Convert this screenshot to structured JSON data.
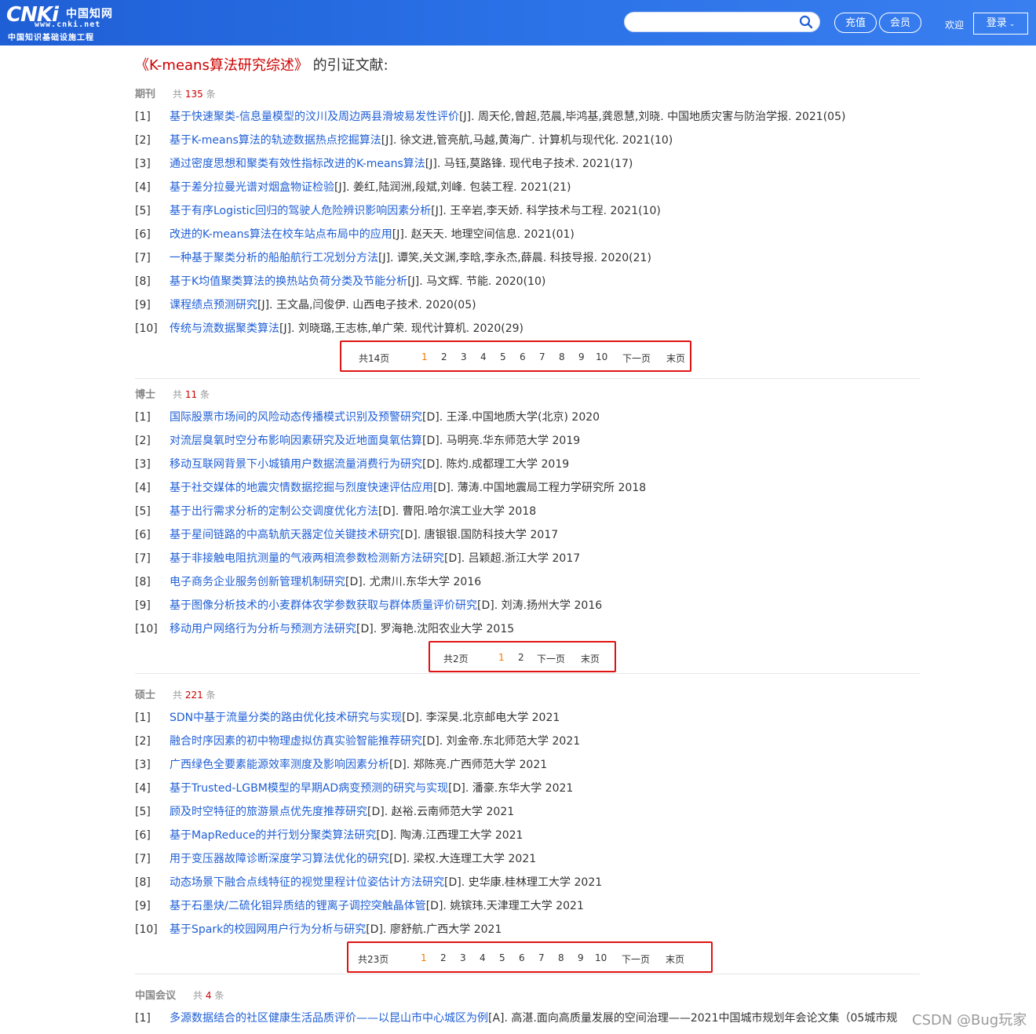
{
  "header": {
    "logo_brand": "CNKi",
    "logo_brand_cn": "中国知网",
    "logo_url": "www.cnki.net",
    "logo_slogan": "中国知识基础设施工程",
    "search_placeholder": "",
    "recharge_label": "充值",
    "member_label": "会员",
    "welcome_label": "欢迎",
    "login_label": "登录"
  },
  "page": {
    "title_link": "《K-means算法研究综述》",
    "title_suffix": "的引证文献:"
  },
  "sections": [
    {
      "name": "期刊",
      "count_prefix": "共",
      "count": "135",
      "count_suffix": "条",
      "rows": [
        {
          "idx": "[1]",
          "title": "基于快速聚类-信息量模型的汶川及周边两县滑坡易发性评价",
          "meta": "[J]. 周天伦,曾超,范晨,毕鸿基,龚恩慧,刘晓.  中国地质灾害与防治学报. 2021(05)"
        },
        {
          "idx": "[2]",
          "title": "基于K-means算法的轨迹数据热点挖掘算法",
          "meta": "[J]. 徐文进,管亮航,马越,黄海广.  计算机与现代化. 2021(10)"
        },
        {
          "idx": "[3]",
          "title": "通过密度思想和聚类有效性指标改进的K-means算法",
          "meta": "[J]. 马钰,莫路锋.  现代电子技术. 2021(17)"
        },
        {
          "idx": "[4]",
          "title": "基于差分拉曼光谱对烟盒物证检验",
          "meta": "[J]. 姜红,陆润洲,段斌,刘峰.  包装工程. 2021(21)"
        },
        {
          "idx": "[5]",
          "title": "基于有序Logistic回归的驾驶人危险辨识影响因素分析",
          "meta": "[J]. 王辛岩,李天娇.  科学技术与工程. 2021(10)"
        },
        {
          "idx": "[6]",
          "title": "改进的K-means算法在校车站点布局中的应用",
          "meta": "[J]. 赵天天.  地理空间信息. 2021(01)"
        },
        {
          "idx": "[7]",
          "title": "一种基于聚类分析的船舶航行工况划分方法",
          "meta": "[J]. 谭笑,关文渊,李晗,李永杰,薛晨.  科技导报. 2020(21)"
        },
        {
          "idx": "[8]",
          "title": "基于K均值聚类算法的换热站负荷分类及节能分析",
          "meta": "[J]. 马文辉.  节能. 2020(10)"
        },
        {
          "idx": "[9]",
          "title": "课程绩点预测研究",
          "meta": "[J]. 王文晶,闫俊伊.  山西电子技术. 2020(05)"
        },
        {
          "idx": "[10]",
          "title": "传统与流数据聚类算法",
          "meta": "[J]. 刘晓璐,王志栋,单广荣.  现代计算机. 2020(29)"
        }
      ],
      "pager": {
        "total": "共14页",
        "pages": [
          "1",
          "2",
          "3",
          "4",
          "5",
          "6",
          "7",
          "8",
          "9",
          "10"
        ],
        "next": "下一页",
        "last": "末页"
      }
    },
    {
      "name": "博士",
      "count_prefix": "共",
      "count": "11",
      "count_suffix": "条",
      "rows": [
        {
          "idx": "[1]",
          "title": "国际股票市场间的风险动态传播模式识别及预警研究",
          "meta": "[D]. 王泽.中国地质大学(北京) 2020"
        },
        {
          "idx": "[2]",
          "title": "对流层臭氧时空分布影响因素研究及近地面臭氧估算",
          "meta": "[D]. 马明亮.华东师范大学 2019"
        },
        {
          "idx": "[3]",
          "title": "移动互联网背景下小城镇用户数据流量消费行为研究",
          "meta": "[D]. 陈灼.成都理工大学 2019"
        },
        {
          "idx": "[4]",
          "title": "基于社交媒体的地震灾情数据挖掘与烈度快速评估应用",
          "meta": "[D]. 薄涛.中国地震局工程力学研究所 2018"
        },
        {
          "idx": "[5]",
          "title": "基于出行需求分析的定制公交调度优化方法",
          "meta": "[D]. 曹阳.哈尔滨工业大学 2018"
        },
        {
          "idx": "[6]",
          "title": "基于星间链路的中高轨航天器定位关键技术研究",
          "meta": "[D]. 唐银银.国防科技大学 2017"
        },
        {
          "idx": "[7]",
          "title": "基于非接触电阻抗测量的气液两相流参数检测新方法研究",
          "meta": "[D]. 吕颖超.浙江大学 2017"
        },
        {
          "idx": "[8]",
          "title": "电子商务企业服务创新管理机制研究",
          "meta": "[D]. 尤肃川.东华大学 2016"
        },
        {
          "idx": "[9]",
          "title": "基于图像分析技术的小麦群体农学参数获取与群体质量评价研究",
          "meta": "[D]. 刘涛.扬州大学 2016"
        },
        {
          "idx": "[10]",
          "title": "移动用户网络行为分析与预测方法研究",
          "meta": "[D]. 罗海艳.沈阳农业大学 2015"
        }
      ],
      "pager": {
        "total": "共2页",
        "pages": [
          "1",
          "2"
        ],
        "next": "下一页",
        "last": "末页"
      }
    },
    {
      "name": "硕士",
      "count_prefix": "共",
      "count": "221",
      "count_suffix": "条",
      "rows": [
        {
          "idx": "[1]",
          "title": "SDN中基于流量分类的路由优化技术研究与实现",
          "meta": "[D]. 李深昊.北京邮电大学 2021"
        },
        {
          "idx": "[2]",
          "title": "融合时序因素的初中物理虚拟仿真实验智能推荐研究",
          "meta": "[D]. 刘金帝.东北师范大学 2021"
        },
        {
          "idx": "[3]",
          "title": "广西绿色全要素能源效率测度及影响因素分析",
          "meta": "[D]. 郑陈亮.广西师范大学 2021"
        },
        {
          "idx": "[4]",
          "title": "基于Trusted-LGBM模型的早期AD病变预测的研究与实现",
          "meta": "[D]. 潘豪.东华大学 2021"
        },
        {
          "idx": "[5]",
          "title": "顾及时空特征的旅游景点优先度推荐研究",
          "meta": "[D]. 赵裕.云南师范大学 2021"
        },
        {
          "idx": "[6]",
          "title": "基于MapReduce的并行划分聚类算法研究",
          "meta": "[D]. 陶涛.江西理工大学 2021"
        },
        {
          "idx": "[7]",
          "title": "用于变压器故障诊断深度学习算法优化的研究",
          "meta": "[D]. 梁权.大连理工大学 2021"
        },
        {
          "idx": "[8]",
          "title": "动态场景下融合点线特征的视觉里程计位姿估计方法研究",
          "meta": "[D]. 史华康.桂林理工大学 2021"
        },
        {
          "idx": "[9]",
          "title": "基于石墨炔/二硫化钼异质结的锂离子调控突触晶体管",
          "meta": "[D]. 姚镔玮.天津理工大学 2021"
        },
        {
          "idx": "[10]",
          "title": "基于Spark的校园网用户行为分析与研究",
          "meta": "[D]. 廖舒航.广西大学 2021"
        }
      ],
      "pager": {
        "total": "共23页",
        "pages": [
          "1",
          "2",
          "3",
          "4",
          "5",
          "6",
          "7",
          "8",
          "9",
          "10"
        ],
        "next": "下一页",
        "last": "末页"
      }
    },
    {
      "name": "中国会议",
      "count_prefix": "共",
      "count": "4",
      "count_suffix": "条",
      "rows": [
        {
          "idx": "[1]",
          "title": "多源数据结合的社区健康生活品质评价——以昆山市中心城区为例",
          "meta": "[A]. 高湛.面向高质量发展的空间治理——2021中国城市规划年会论文集（05城市规"
        }
      ]
    }
  ],
  "watermark": "CSDN @Bug玩家"
}
